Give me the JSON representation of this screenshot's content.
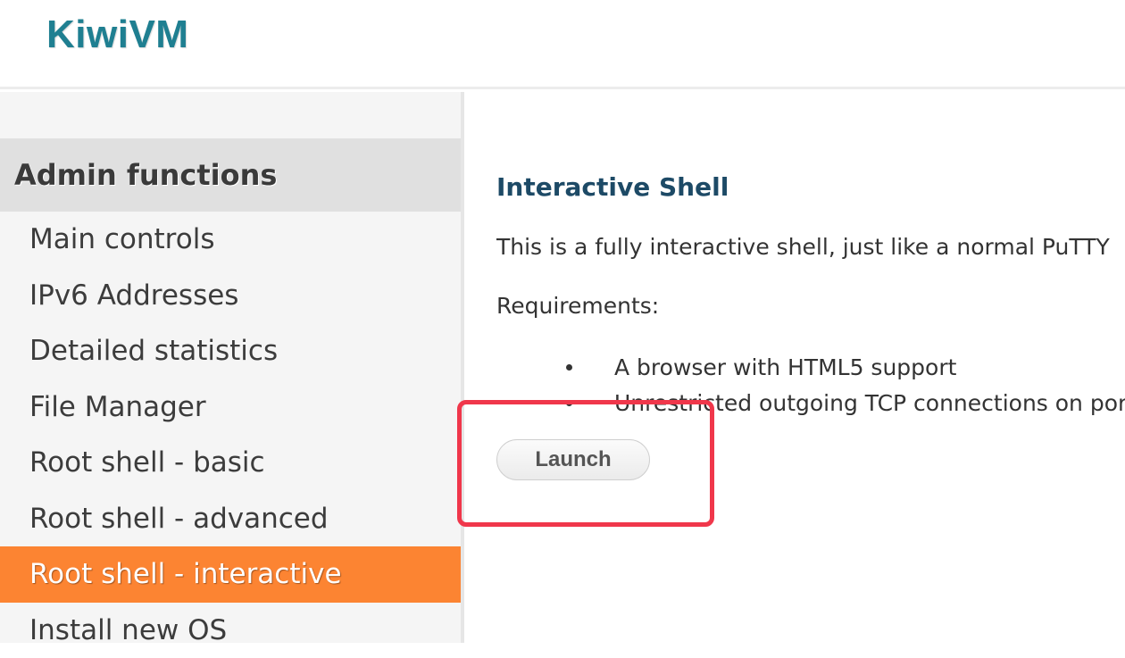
{
  "header": {
    "logo": "KiwiVM"
  },
  "sidebar": {
    "heading": "Admin functions",
    "items": [
      {
        "label": "Main controls",
        "active": false
      },
      {
        "label": "IPv6 Addresses",
        "active": false
      },
      {
        "label": "Detailed statistics",
        "active": false
      },
      {
        "label": "File Manager",
        "active": false
      },
      {
        "label": "Root shell - basic",
        "active": false
      },
      {
        "label": "Root shell - advanced",
        "active": false
      },
      {
        "label": "Root shell - interactive",
        "active": true
      },
      {
        "label": "Install new OS",
        "active": false
      }
    ]
  },
  "main": {
    "title": "Interactive Shell",
    "description": "This is a fully interactive shell, just like a normal PuTTY",
    "requirements_label": "Requirements:",
    "requirements": [
      "A browser with HTML5 support",
      "Unrestricted outgoing TCP connections on port"
    ],
    "launch_label": "Launch"
  },
  "colors": {
    "logo": "#1f7f91",
    "active_item": "#fc8432",
    "title": "#1d4a66",
    "highlight": "#f0374b"
  }
}
